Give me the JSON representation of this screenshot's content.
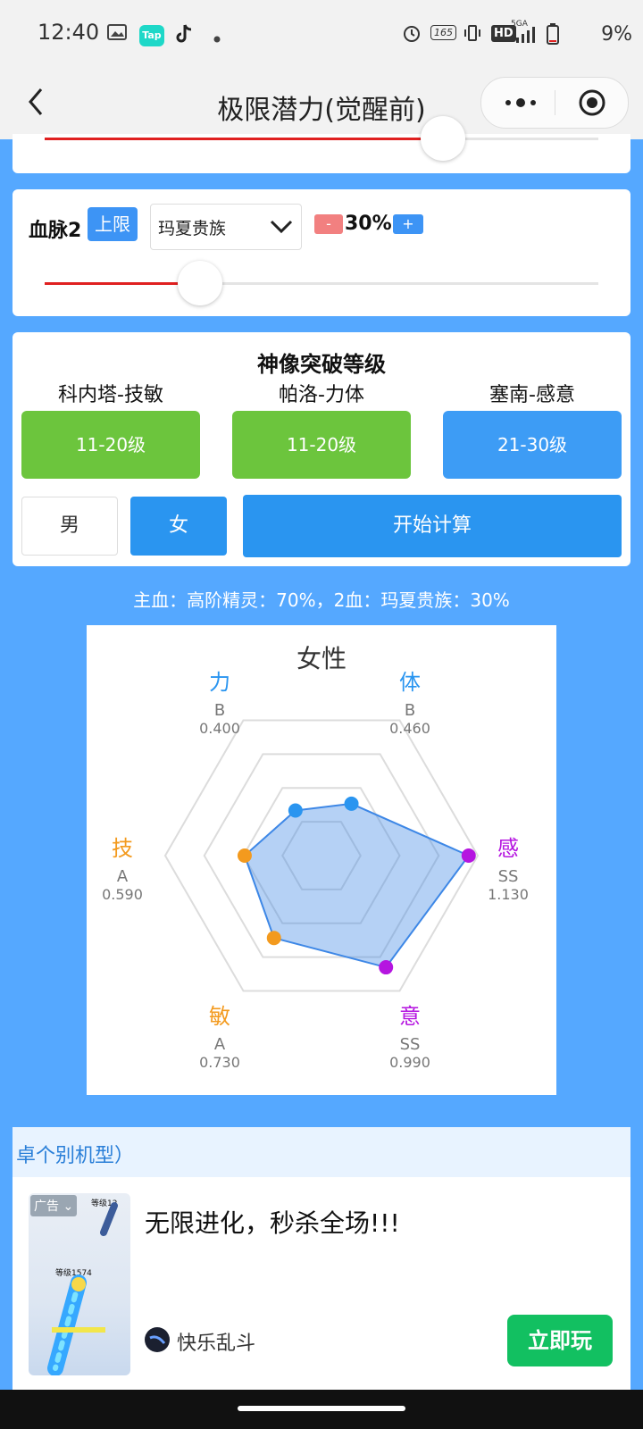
{
  "status": {
    "time": "12:40",
    "battery": "9%",
    "icons": [
      "gallery-icon",
      "taptap-icon",
      "tiktok-icon",
      "dot-icon",
      "alarm-icon",
      "refresh-rate-icon",
      "vibrate-icon",
      "hd-icon",
      "signal-5g-icon",
      "battery-icon"
    ],
    "taptap_label": "Tap",
    "refresh_label": "165",
    "hd_label": "HD",
    "net_label": "5GA"
  },
  "nav": {
    "title": "极限潜力(觉醒前)"
  },
  "slider1": {
    "value_fraction": 0.72
  },
  "blood2": {
    "label": "血脉2",
    "limit_tag": "上限",
    "select_value": "玛夏贵族",
    "minus": "-",
    "percent": "30%",
    "plus": "+",
    "slider_fraction": 0.28
  },
  "breakthrough": {
    "title": "神像突破等级",
    "columns": [
      {
        "name": "科内塔-技敏",
        "level": "11-20级",
        "color": "#6cc53d"
      },
      {
        "name": "帕洛-力体",
        "level": "11-20级",
        "color": "#6cc53d"
      },
      {
        "name": "塞南-感意",
        "level": "21-30级",
        "color": "#3d9cf5"
      }
    ],
    "gender_male": "男",
    "gender_female": "女",
    "start_button": "开始计算"
  },
  "summary": "主血：高阶精灵：70%，2血：玛夏贵族：30%",
  "chart_data": {
    "type": "radar",
    "title": "女性",
    "axes": [
      {
        "name": "力",
        "grade": "B",
        "value": 0.4,
        "color": "#2a95f0"
      },
      {
        "name": "体",
        "grade": "B",
        "value": 0.46,
        "color": "#2a95f0"
      },
      {
        "name": "感",
        "grade": "SS",
        "value": 1.13,
        "color": "#b515e0"
      },
      {
        "name": "意",
        "grade": "SS",
        "value": 0.99,
        "color": "#b515e0"
      },
      {
        "name": "敏",
        "grade": "A",
        "value": 0.73,
        "color": "#f39a1e"
      },
      {
        "name": "技",
        "grade": "A",
        "value": 0.59,
        "color": "#f39a1e"
      }
    ],
    "value_labels": [
      "0.400",
      "0.460",
      "1.130",
      "0.990",
      "0.730",
      "0.590"
    ],
    "max": 1.2,
    "rings": 4,
    "area_color": "#3d87e6"
  },
  "notice": "卓个别机型）",
  "ad": {
    "tag": "广告",
    "headline": "无限进化，秒杀全场!!!",
    "app_name": "快乐乱斗",
    "cta": "立即玩",
    "thumb_level_top": "等级12",
    "thumb_level_mid": "等级1574"
  }
}
